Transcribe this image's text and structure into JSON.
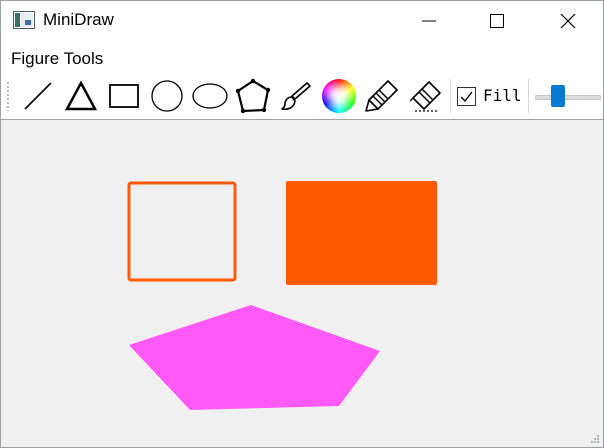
{
  "window": {
    "title": "MiniDraw",
    "controls": [
      "minimize",
      "maximize",
      "close"
    ]
  },
  "menubar": {
    "items": [
      {
        "label": "Figure Tools"
      }
    ]
  },
  "toolbar": {
    "tools": [
      {
        "name": "line",
        "icon": "line-icon"
      },
      {
        "name": "triangle",
        "icon": "triangle-icon"
      },
      {
        "name": "rectangle",
        "icon": "rectangle-icon"
      },
      {
        "name": "circle",
        "icon": "circle-icon"
      },
      {
        "name": "ellipse",
        "icon": "ellipse-icon"
      },
      {
        "name": "polygon",
        "icon": "polygon-icon"
      },
      {
        "name": "brush",
        "icon": "brush-icon"
      },
      {
        "name": "color",
        "icon": "color-wheel-icon"
      },
      {
        "name": "freehand",
        "icon": "freehand-icon"
      },
      {
        "name": "eraser",
        "icon": "eraser-icon"
      }
    ],
    "fill": {
      "label": "Fill",
      "checked": true
    },
    "width_slider": {
      "value_fraction": 0.3
    }
  },
  "canvas": {
    "background": "#f0f0f0",
    "shapes": [
      {
        "type": "rectangle",
        "filled": false,
        "color": "#ff5a0a"
      },
      {
        "type": "rectangle",
        "filled": true,
        "color": "#ff5a00"
      },
      {
        "type": "pentagon",
        "filled": true,
        "color": "#ff5af5"
      }
    ]
  },
  "colors": {
    "accent": "#0a7ad4",
    "orange": "#ff5a00",
    "magenta": "#ff5af5"
  }
}
